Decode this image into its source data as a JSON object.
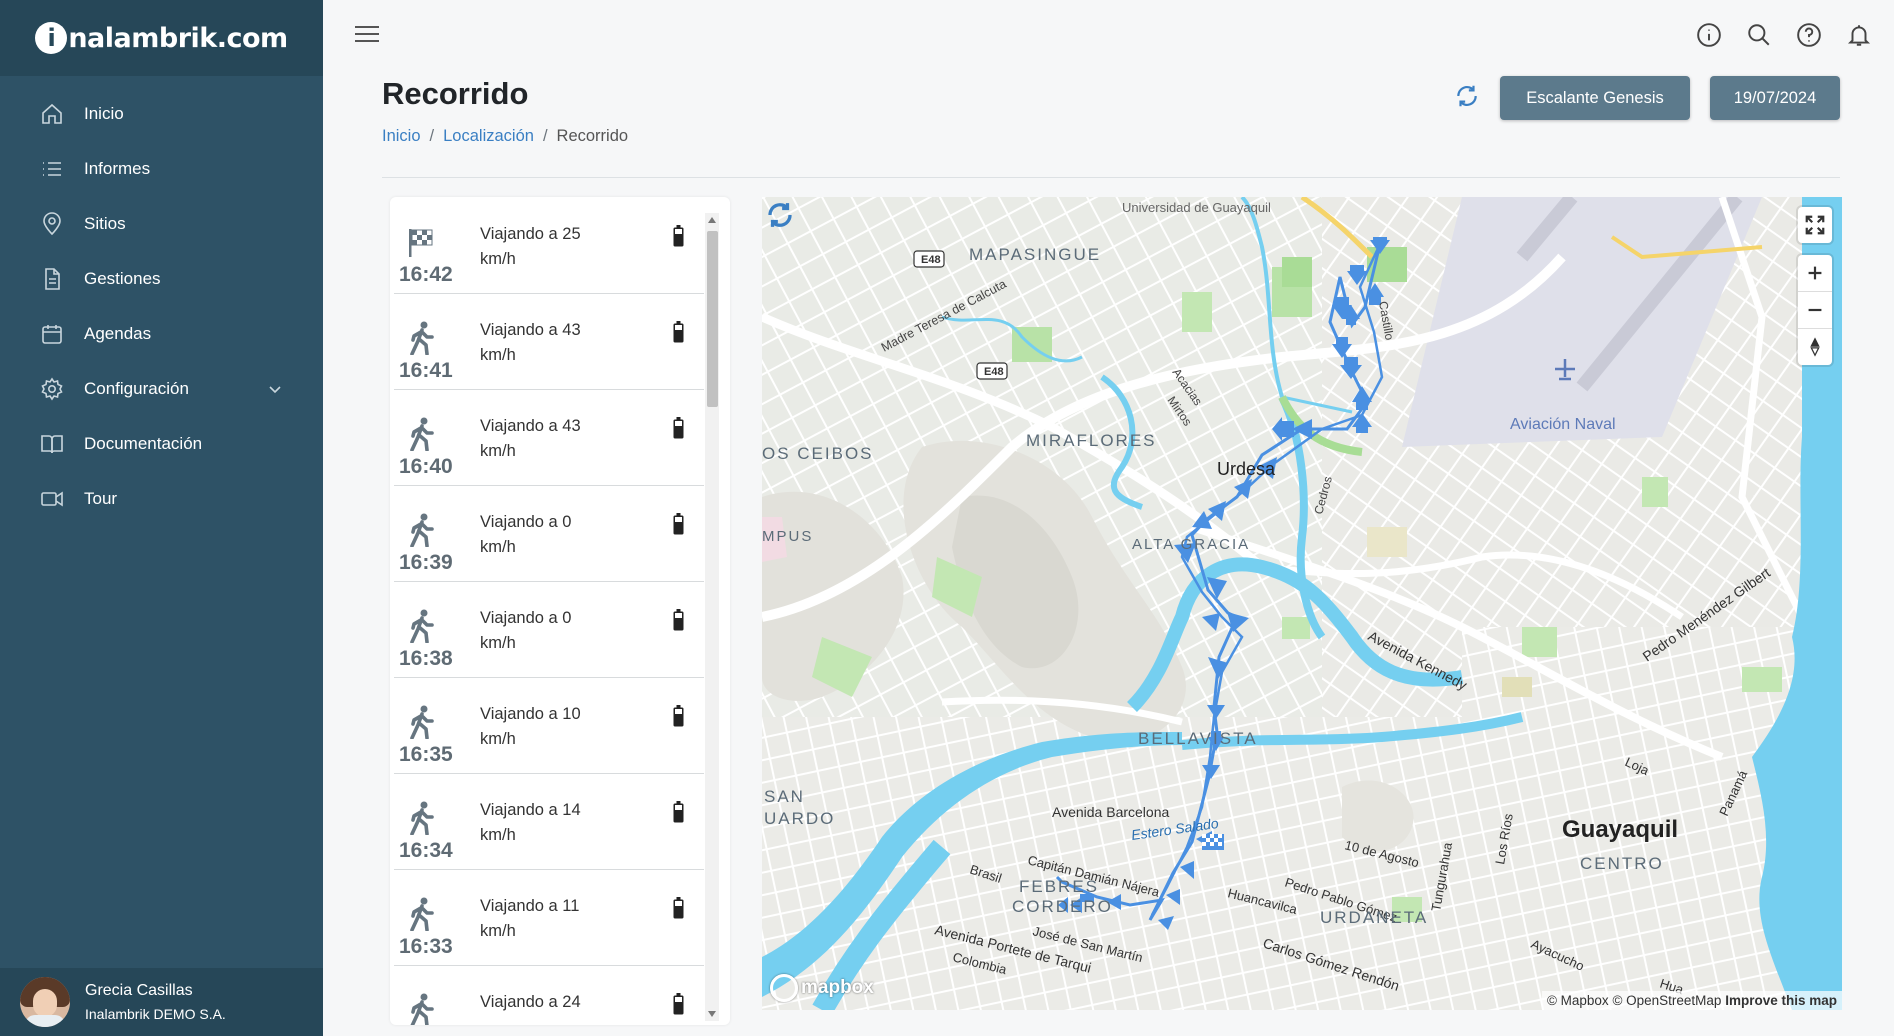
{
  "brand": {
    "logo_letter": "i",
    "logo_rest": "nalambrik.com"
  },
  "sidebar": {
    "items": [
      {
        "label": "Inicio",
        "icon": "home-icon"
      },
      {
        "label": "Informes",
        "icon": "list-icon"
      },
      {
        "label": "Sitios",
        "icon": "map-pin-icon"
      },
      {
        "label": "Gestiones",
        "icon": "document-icon"
      },
      {
        "label": "Agendas",
        "icon": "calendar-icon"
      },
      {
        "label": "Configuración",
        "icon": "gear-icon"
      },
      {
        "label": "Documentación",
        "icon": "book-icon"
      },
      {
        "label": "Tour",
        "icon": "video-camera-icon"
      }
    ]
  },
  "user": {
    "name": "Grecia Casillas",
    "company": "Inalambrik DEMO S.A."
  },
  "page": {
    "title": "Recorrido"
  },
  "breadcrumb": {
    "home": "Inicio",
    "section": "Localización",
    "current": "Recorrido"
  },
  "header": {
    "device_label": "Escalante Genesis",
    "date_label": "19/07/2024"
  },
  "events": [
    {
      "time": "16:42",
      "text": "Viajando a 25 km/h",
      "icon": "checkered-flag-icon"
    },
    {
      "time": "16:41",
      "text": "Viajando a 43 km/h",
      "icon": "walking-person-icon"
    },
    {
      "time": "16:40",
      "text": "Viajando a 43 km/h",
      "icon": "walking-person-icon"
    },
    {
      "time": "16:39",
      "text": "Viajando a 0 km/h",
      "icon": "walking-person-icon"
    },
    {
      "time": "16:38",
      "text": "Viajando a 0 km/h",
      "icon": "walking-person-icon"
    },
    {
      "time": "16:35",
      "text": "Viajando a 10 km/h",
      "icon": "walking-person-icon"
    },
    {
      "time": "16:34",
      "text": "Viajando a 14 km/h",
      "icon": "walking-person-icon"
    },
    {
      "time": "16:33",
      "text": "Viajando a 11 km/h",
      "icon": "walking-person-icon"
    },
    {
      "time": "",
      "text": "Viajando a 24",
      "icon": "walking-person-icon"
    }
  ],
  "map": {
    "labels": {
      "universidad": "Universidad de Guayaquil",
      "mapasingue": "MAPASINGUE",
      "e48a": "E48",
      "e48b": "E48",
      "madre_teresa": "Madre Teresa de Calcuta",
      "miraflores": "MIRAFLORES",
      "los_ceibos": "OS CEIBOS",
      "acacias": "Acacias",
      "mirtos": "Mirtos",
      "urdesa": "Urdesa",
      "cedros": "Cedros",
      "castillo": "Castillo",
      "campus": "MPUS",
      "alta_gracia": "ALTA GRACIA",
      "aviacion": "Aviación Naval",
      "kennedy": "Avenida Kennedy",
      "pedro_menendez": "Pedro Menéndez Gilbert",
      "bellavista": "BELLAVISTA",
      "san": "SAN",
      "uardo": "UARDO",
      "barcelona": "Avenida Barcelona",
      "estero": "Estero Salado",
      "brasil": "Brasil",
      "capitan": "Capitán Damián Nájera",
      "huancavilca": "Huancavilca",
      "pedro_pablo": "Pedro Pablo Gómez",
      "diez_agosto": "10 de Agosto",
      "tungurahua": "Tungurahua",
      "los_rios": "Los Ríos",
      "guayaquil": "Guayaquil",
      "loja": "Loja",
      "panama": "Panamá",
      "centro": "CENTRO",
      "febres": "FEBRES",
      "cordero": "CORDERO",
      "urdaneta": "URDANETA",
      "ayacucho": "Ayacucho",
      "portete": "Avenida Portete de Tarqui",
      "san_martin": "José de San Martín",
      "carlos_gomez": "Carlos Gómez Rendón",
      "colombia": "Colombia",
      "hua": "Hua"
    },
    "attribution": {
      "mapbox": "© Mapbox",
      "osm": "© OpenStreetMap",
      "improve": "Improve this map"
    },
    "logo": "mapbox"
  }
}
